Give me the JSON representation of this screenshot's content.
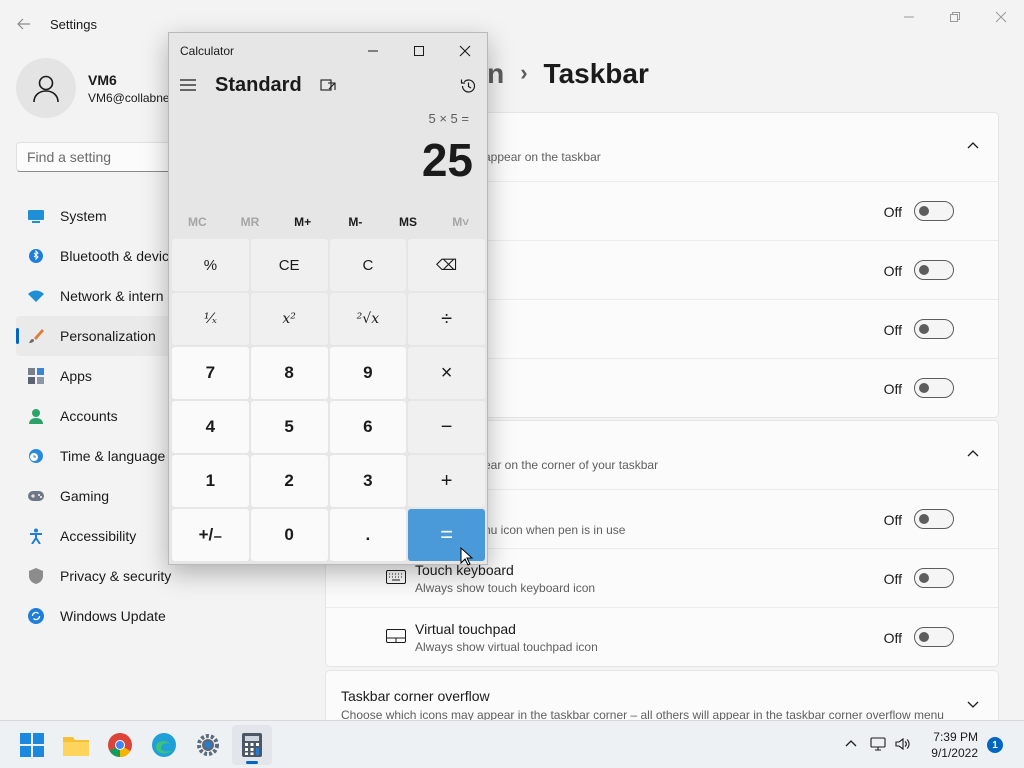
{
  "settings_window": {
    "title": "Settings",
    "profile": {
      "name": "VM6",
      "email": "VM6@collabne"
    },
    "search": {
      "placeholder": "Find a setting"
    },
    "nav": [
      {
        "label": "System",
        "icon": "monitor-icon"
      },
      {
        "label": "Bluetooth & devic",
        "icon": "bluetooth-icon"
      },
      {
        "label": "Network & intern",
        "icon": "wifi-icon"
      },
      {
        "label": "Personalization",
        "icon": "brush-icon",
        "active": true
      },
      {
        "label": "Apps",
        "icon": "apps-icon"
      },
      {
        "label": "Accounts",
        "icon": "person-icon"
      },
      {
        "label": "Time & language",
        "icon": "clock-globe-icon"
      },
      {
        "label": "Gaming",
        "icon": "gamepad-icon"
      },
      {
        "label": "Accessibility",
        "icon": "accessibility-icon"
      },
      {
        "label": "Privacy & security",
        "icon": "shield-icon"
      },
      {
        "label": "Windows Update",
        "icon": "update-icon"
      }
    ],
    "breadcrumb": {
      "parent": "on",
      "separator": "›",
      "current": "Taskbar"
    },
    "taskbar_items_card": {
      "subtitle": "appear on the taskbar",
      "rows": [
        {
          "state": "Off",
          "on": false
        },
        {
          "state": "Off",
          "on": false
        },
        {
          "state": "Off",
          "on": false
        },
        {
          "state": "Off",
          "on": false
        }
      ]
    },
    "corner_icons_card": {
      "subtitle": "ear on the corner of your taskbar",
      "rows": [
        {
          "title": "",
          "subtitle": "nu icon when pen is in use",
          "state": "Off",
          "on": false,
          "icon": ""
        },
        {
          "title": "Touch keyboard",
          "subtitle": "Always show touch keyboard icon",
          "state": "Off",
          "on": false,
          "icon": "keyboard-icon"
        },
        {
          "title": "Virtual touchpad",
          "subtitle": "Always show virtual touchpad icon",
          "state": "Off",
          "on": false,
          "icon": "touchpad-icon"
        }
      ]
    },
    "overflow_card": {
      "title": "Taskbar corner overflow",
      "subtitle": "Choose which icons may appear in the taskbar corner – all others will appear in the taskbar corner overflow menu"
    }
  },
  "calculator": {
    "title": "Calculator",
    "mode": "Standard",
    "expression": "5 × 5 =",
    "result": "25",
    "memory": [
      {
        "label": "MC",
        "enabled": false
      },
      {
        "label": "MR",
        "enabled": false
      },
      {
        "label": "M+",
        "enabled": true
      },
      {
        "label": "M-",
        "enabled": true
      },
      {
        "label": "MS",
        "enabled": true
      },
      {
        "label": "M˅",
        "enabled": false
      }
    ],
    "keys": [
      {
        "label": "%",
        "kind": "fnk",
        "name": "percent-key"
      },
      {
        "label": "CE",
        "kind": "fnk",
        "name": "clear-entry-key"
      },
      {
        "label": "C",
        "kind": "fnk",
        "name": "clear-key"
      },
      {
        "label": "⌫",
        "kind": "fnk",
        "name": "backspace-key"
      },
      {
        "label": "¹⁄ₓ",
        "kind": "fn",
        "name": "reciprocal-key"
      },
      {
        "label": "x²",
        "kind": "fn",
        "name": "square-key"
      },
      {
        "label": "²√x",
        "kind": "fn",
        "name": "square-root-key"
      },
      {
        "label": "÷",
        "kind": "op",
        "name": "divide-key"
      },
      {
        "label": "7",
        "kind": "num",
        "name": "digit-7-key"
      },
      {
        "label": "8",
        "kind": "num",
        "name": "digit-8-key"
      },
      {
        "label": "9",
        "kind": "num",
        "name": "digit-9-key"
      },
      {
        "label": "×",
        "kind": "op",
        "name": "multiply-key"
      },
      {
        "label": "4",
        "kind": "num",
        "name": "digit-4-key"
      },
      {
        "label": "5",
        "kind": "num",
        "name": "digit-5-key"
      },
      {
        "label": "6",
        "kind": "num",
        "name": "digit-6-key"
      },
      {
        "label": "−",
        "kind": "op",
        "name": "subtract-key"
      },
      {
        "label": "1",
        "kind": "num",
        "name": "digit-1-key"
      },
      {
        "label": "2",
        "kind": "num",
        "name": "digit-2-key"
      },
      {
        "label": "3",
        "kind": "num",
        "name": "digit-3-key"
      },
      {
        "label": "+",
        "kind": "op",
        "name": "add-key"
      },
      {
        "label": "+/₋",
        "kind": "num",
        "name": "negate-key"
      },
      {
        "label": "0",
        "kind": "num",
        "name": "digit-0-key"
      },
      {
        "label": ".",
        "kind": "num",
        "name": "decimal-key"
      },
      {
        "label": "=",
        "kind": "eq",
        "name": "equals-key"
      }
    ]
  },
  "taskbar": {
    "apps": [
      "start-icon",
      "file-explorer-icon",
      "chrome-icon",
      "edge-icon",
      "settings-gear-icon",
      "calculator-icon"
    ],
    "clock": {
      "time": "7:39 PM",
      "date": "9/1/2022"
    },
    "notification_count": "1"
  },
  "colors": {
    "accent": "#0067c0",
    "equals_key": "#4a9ad9"
  }
}
